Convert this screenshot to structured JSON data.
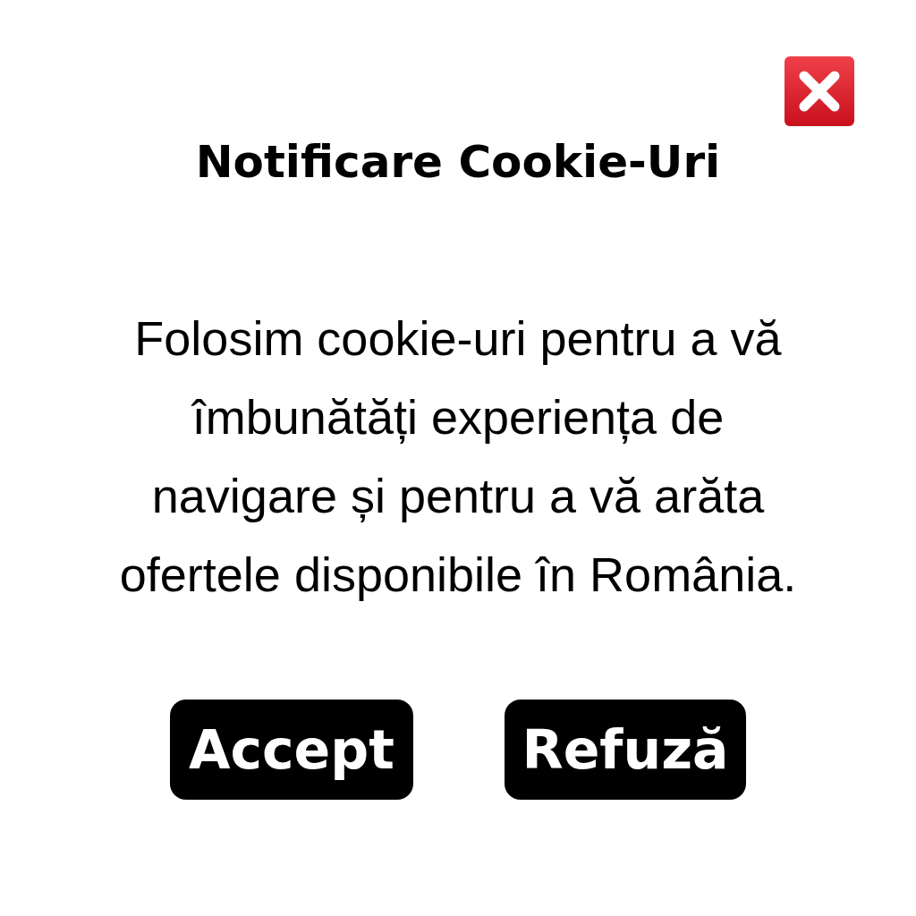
{
  "dialog": {
    "title": "Notificare Cookie-Uri",
    "message": "Folosim cookie-uri pentru a vă îmbunătăți experiența de navigare și pentru a vă arăta ofertele disponibile în România.",
    "buttons": [
      {
        "label": "Accept"
      },
      {
        "label": "Refuză"
      }
    ]
  }
}
